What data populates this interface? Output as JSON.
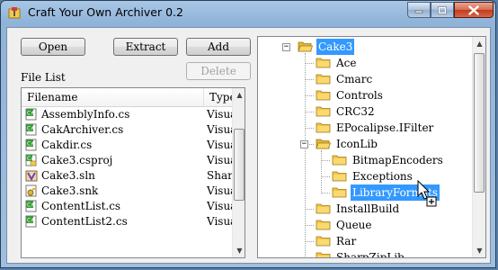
{
  "window": {
    "title": "Craft Your Own Archiver 0.2"
  },
  "toolbar": {
    "open_label": "Open",
    "extract_label": "Extract",
    "add_label": "Add",
    "delete_label": "Delete"
  },
  "file_list": {
    "label": "File List",
    "columns": [
      "Filename",
      "Type"
    ],
    "rows": [
      {
        "name": "AssemblyInfo.cs",
        "type": "Visual",
        "icon": "csharp-file-icon"
      },
      {
        "name": "CakArchiver.cs",
        "type": "Visual",
        "icon": "csharp-file-icon"
      },
      {
        "name": "Cakdir.cs",
        "type": "Visual",
        "icon": "csharp-file-icon"
      },
      {
        "name": "Cake3.csproj",
        "type": "Visual",
        "icon": "csproj-file-icon"
      },
      {
        "name": "Cake3.sln",
        "type": "SharpI",
        "icon": "solution-file-icon"
      },
      {
        "name": "Cake3.snk",
        "type": "Visual",
        "icon": "key-file-icon"
      },
      {
        "name": "ContentList.cs",
        "type": "Visual",
        "icon": "csharp-file-icon"
      },
      {
        "name": "ContentList2.cs",
        "type": "Visual",
        "icon": "csharp-file-icon"
      }
    ]
  },
  "tree": {
    "root": "Cake3",
    "items": [
      "Ace",
      "Cmarc",
      "Controls",
      "CRC32",
      "EPocalipse.IFilter",
      "IconLib",
      "InstallBuild",
      "Queue",
      "Rar",
      "SharpZipLib"
    ],
    "iconlib_children": [
      "BitmapEncoders",
      "Exceptions",
      "LibraryFormats"
    ],
    "selected": "LibraryFormats"
  },
  "colors": {
    "selection": "#3399ff",
    "folder": "#f5c542",
    "titlebar": "#9ebfe1"
  }
}
